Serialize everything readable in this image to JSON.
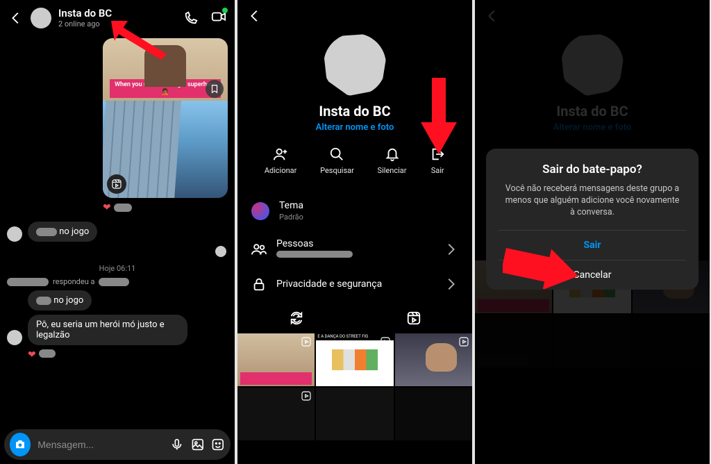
{
  "panel1": {
    "chat_name": "Insta do BC",
    "status": "2 online ago",
    "meme_caption": "When you suck at being a superhero🤦🏾",
    "timestamp": "Hoje 06:11",
    "reply_snippet": "respondeu a",
    "msg_in1": "no jogo",
    "msg_in2": "no jogo",
    "msg_in3": "Pô, eu seria um herói mó justo e legalzão",
    "composer_placeholder": "Mensagem..."
  },
  "panel2": {
    "title": "Insta do BC",
    "edit_link": "Alterar nome e foto",
    "actions": {
      "add": "Adicionar",
      "search": "Pesquisar",
      "mute": "Silenciar",
      "leave": "Sair"
    },
    "theme_label": "Tema",
    "theme_value": "Padrão",
    "people_label": "Pessoas",
    "privacy_label": "Privacidade e segurança",
    "thumb_b_caption": "E A DANÇA DO STREET FIG"
  },
  "panel3": {
    "title": "Insta do BC",
    "edit_link": "Alterar nome e foto",
    "modal_title": "Sair do bate-papo?",
    "modal_body": "Você não receberá mensagens deste grupo a menos que alguém adicione você novamente à conversa.",
    "modal_primary": "Sair",
    "modal_cancel": "Cancelar"
  }
}
